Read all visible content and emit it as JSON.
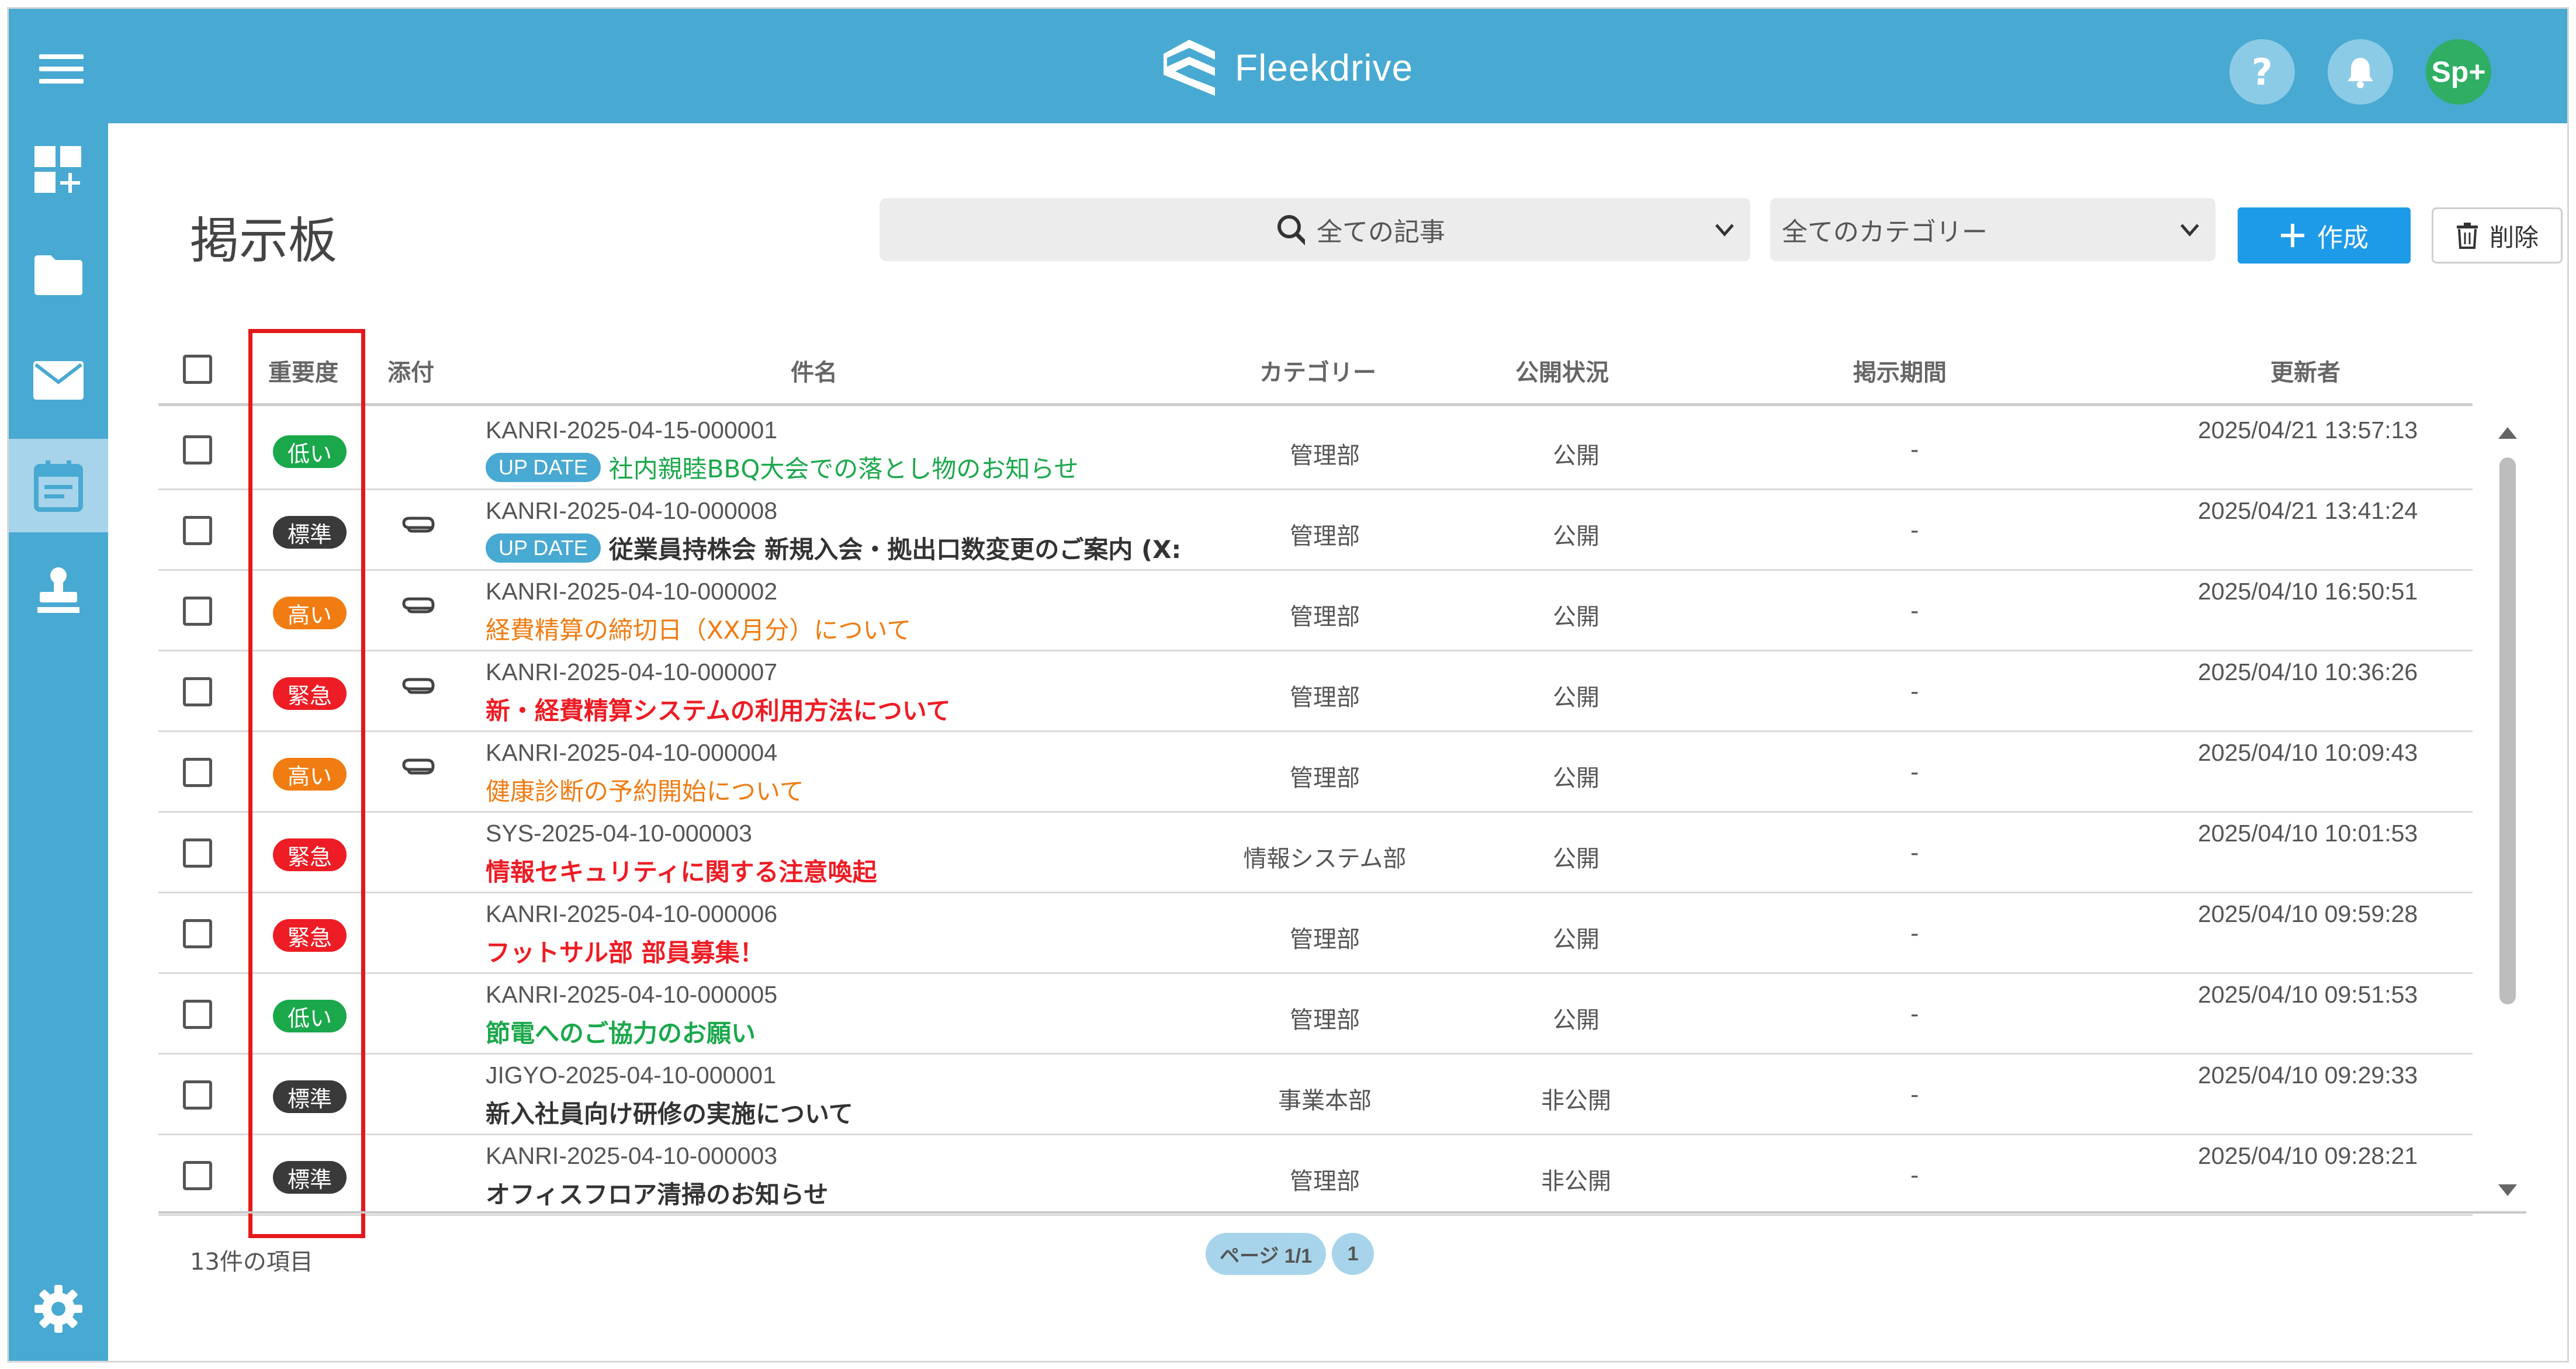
{
  "header": {
    "brand": "Fleekdrive",
    "help_label": "?",
    "avatar_label": "Sp+"
  },
  "sidebar": {
    "items": [
      {
        "name": "dashboard-add-icon"
      },
      {
        "name": "folder-icon"
      },
      {
        "name": "mail-icon"
      },
      {
        "name": "calendar-board-icon",
        "active": true
      },
      {
        "name": "stamp-icon"
      }
    ],
    "settings": "gear-icon"
  },
  "page": {
    "title": "掲示板",
    "search_placeholder": "",
    "filter_articles": "全ての記事",
    "filter_category": "全てのカテゴリー",
    "create_label": "作成",
    "delete_label": "削除"
  },
  "table": {
    "headers": {
      "importance": "重要度",
      "attachment": "添付",
      "subject": "件名",
      "category": "カテゴリー",
      "status": "公開状況",
      "period": "掲示期間",
      "updated_by": "更新者"
    },
    "rows": [
      {
        "importance": "低い",
        "color": "#1aa84b",
        "attach": false,
        "code": "KANRI-2025-04-15-000001",
        "update": "UP DATE",
        "subject": "社内親睦BBQ大会での落とし物のお知らせ",
        "subject_color": "#1aa84b",
        "bold": false,
        "category": "管理部",
        "status": "公開",
        "period": "-",
        "updated": "2025/04/21 13:57:13"
      },
      {
        "importance": "標準",
        "color": "#3a3a3a",
        "attach": true,
        "code": "KANRI-2025-04-10-000008",
        "update": "UP DATE",
        "subject": "従業員持株会 新規入会・拠出口数変更のご案内 (X:",
        "subject_color": "#333333",
        "bold": true,
        "category": "管理部",
        "status": "公開",
        "period": "-",
        "updated": "2025/04/21 13:41:24"
      },
      {
        "importance": "高い",
        "color": "#f07c12",
        "attach": true,
        "code": "KANRI-2025-04-10-000002",
        "update": "",
        "subject": "経費精算の締切日（XX月分）について",
        "subject_color": "#f07c12",
        "bold": false,
        "category": "管理部",
        "status": "公開",
        "period": "-",
        "updated": "2025/04/10 16:50:51"
      },
      {
        "importance": "緊急",
        "color": "#ee1c24",
        "attach": true,
        "code": "KANRI-2025-04-10-000007",
        "update": "",
        "subject": "新・経費精算システムの利用方法について",
        "subject_color": "#ee1c24",
        "bold": true,
        "category": "管理部",
        "status": "公開",
        "period": "-",
        "updated": "2025/04/10 10:36:26"
      },
      {
        "importance": "高い",
        "color": "#f07c12",
        "attach": true,
        "code": "KANRI-2025-04-10-000004",
        "update": "",
        "subject": "健康診断の予約開始について",
        "subject_color": "#f07c12",
        "bold": false,
        "category": "管理部",
        "status": "公開",
        "period": "-",
        "updated": "2025/04/10 10:09:43"
      },
      {
        "importance": "緊急",
        "color": "#ee1c24",
        "attach": false,
        "code": "SYS-2025-04-10-000003",
        "update": "",
        "subject": "情報セキュリティに関する注意喚起",
        "subject_color": "#ee1c24",
        "bold": true,
        "category": "情報システム部",
        "status": "公開",
        "period": "-",
        "updated": "2025/04/10 10:01:53"
      },
      {
        "importance": "緊急",
        "color": "#ee1c24",
        "attach": false,
        "code": "KANRI-2025-04-10-000006",
        "update": "",
        "subject": "フットサル部 部員募集！",
        "subject_color": "#ee1c24",
        "bold": true,
        "category": "管理部",
        "status": "公開",
        "period": "-",
        "updated": "2025/04/10 09:59:28"
      },
      {
        "importance": "低い",
        "color": "#1aa84b",
        "attach": false,
        "code": "KANRI-2025-04-10-000005",
        "update": "",
        "subject": "節電へのご協力のお願い",
        "subject_color": "#1aa84b",
        "bold": true,
        "category": "管理部",
        "status": "公開",
        "period": "-",
        "updated": "2025/04/10 09:51:53"
      },
      {
        "importance": "標準",
        "color": "#3a3a3a",
        "attach": false,
        "code": "JIGYO-2025-04-10-000001",
        "update": "",
        "subject": "新入社員向け研修の実施について",
        "subject_color": "#333333",
        "bold": true,
        "category": "事業本部",
        "status": "非公開",
        "period": "-",
        "updated": "2025/04/10 09:29:33"
      },
      {
        "importance": "標準",
        "color": "#3a3a3a",
        "attach": false,
        "code": "KANRI-2025-04-10-000003",
        "update": "",
        "subject": "オフィスフロア清掃のお知らせ",
        "subject_color": "#333333",
        "bold": true,
        "category": "管理部",
        "status": "非公開",
        "period": "-",
        "updated": "2025/04/10 09:28:21"
      }
    ]
  },
  "footer": {
    "item_count": "13件の項目",
    "page_label": "ページ 1/1",
    "page_number": "1"
  }
}
